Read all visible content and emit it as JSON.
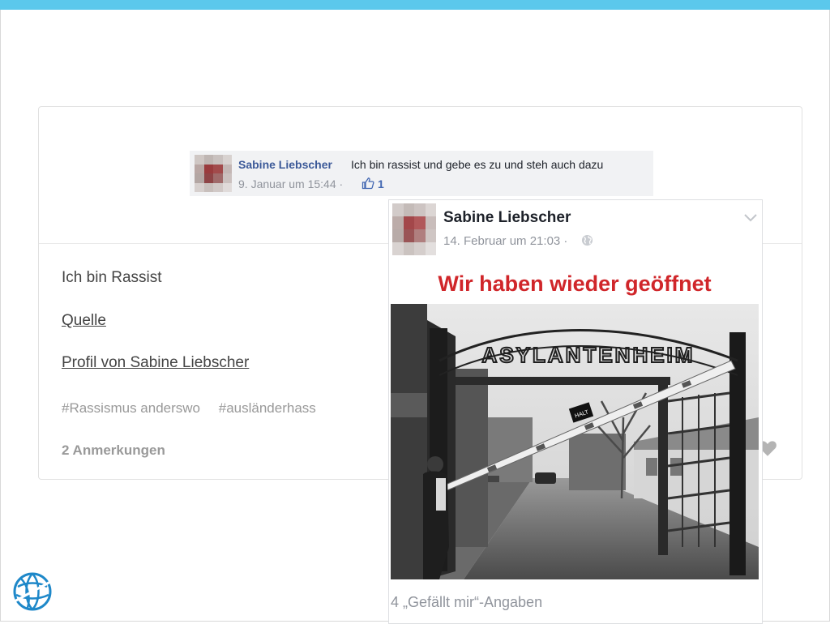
{
  "card": {
    "title": "Ich bin Rassist",
    "link_source": "Quelle",
    "link_profile": "Profil von Sabine Liebscher",
    "tags": [
      "#Rassismus anderswo",
      "#ausländerhass"
    ],
    "notes": "2 Anmerkungen"
  },
  "comment": {
    "author": "Sabine Liebscher",
    "text": "Ich bin rassist und gebe es zu und steh auch dazu",
    "meta": "9. Januar um 15:44 ·",
    "like_count": "1"
  },
  "post": {
    "author": "Sabine Liebscher",
    "meta": "14. Februar um 21:03 ·",
    "image_headline": "Wir haben wieder geöffnet",
    "sign_text": "ASYLANTENHEIM",
    "halt_text": "HALT",
    "likes": "4 „Gefällt mir“-Angaben"
  },
  "colors": {
    "accent_bar": "#5bc8ec",
    "facebook_blue": "#3b5998",
    "headline_red": "#d0262a"
  },
  "icons": [
    "like-icon",
    "globe-icon",
    "chevron-down-icon",
    "heart-icon",
    "globe-logo-icon"
  ]
}
